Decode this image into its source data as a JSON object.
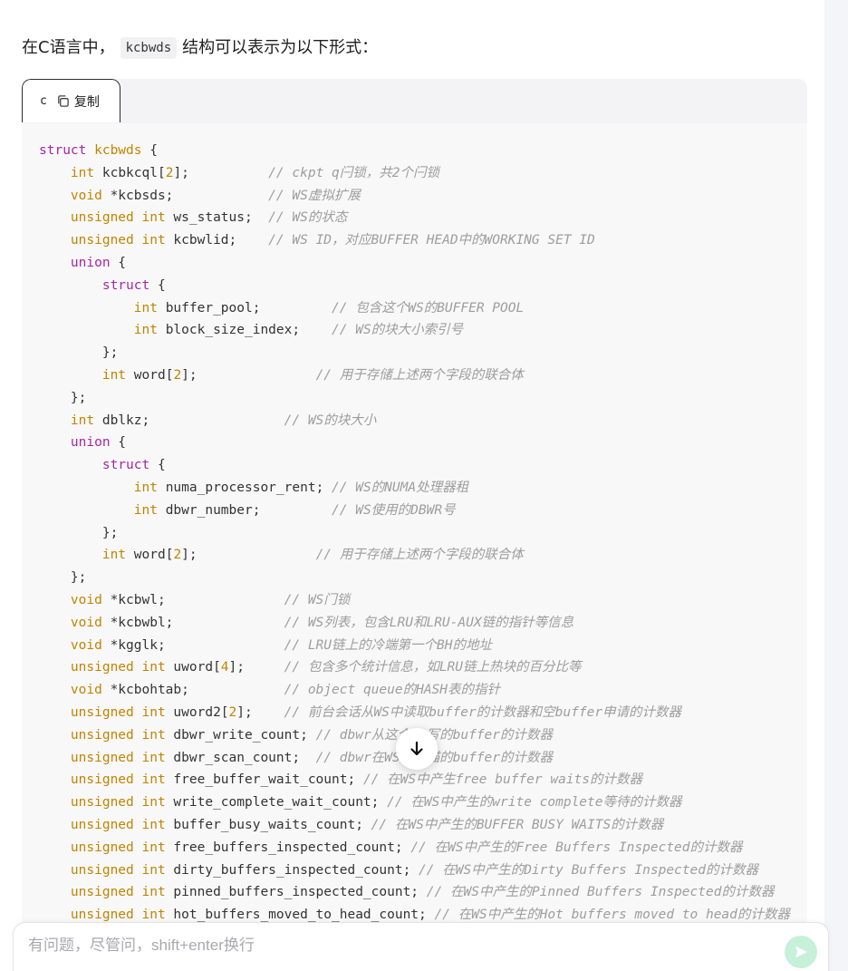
{
  "intro": {
    "before": "在C语言中，",
    "code": "kcbwds",
    "after": "结构可以表示为以下形式："
  },
  "code_tab": {
    "language": "c",
    "copy_label": "复制"
  },
  "code_lines": [
    [
      {
        "t": "kw",
        "v": "struct "
      },
      {
        "t": "ty",
        "v": "kcbwds"
      },
      {
        "t": "p",
        "v": " {"
      }
    ],
    [
      {
        "t": "p",
        "v": "    "
      },
      {
        "t": "ty",
        "v": "int"
      },
      {
        "t": "p",
        "v": " kcbkcql["
      },
      {
        "t": "n",
        "v": "2"
      },
      {
        "t": "p",
        "v": "];          "
      },
      {
        "t": "c",
        "v": "// ckpt q闩锁，共2个闩锁"
      }
    ],
    [
      {
        "t": "p",
        "v": "    "
      },
      {
        "t": "ty",
        "v": "void"
      },
      {
        "t": "p",
        "v": " *kcbsds;            "
      },
      {
        "t": "c",
        "v": "// WS虚拟扩展"
      }
    ],
    [
      {
        "t": "p",
        "v": "    "
      },
      {
        "t": "ty",
        "v": "unsigned int"
      },
      {
        "t": "p",
        "v": " ws_status;  "
      },
      {
        "t": "c",
        "v": "// WS的状态"
      }
    ],
    [
      {
        "t": "p",
        "v": "    "
      },
      {
        "t": "ty",
        "v": "unsigned int"
      },
      {
        "t": "p",
        "v": " kcbwlid;    "
      },
      {
        "t": "c",
        "v": "// WS ID，对应BUFFER HEAD中的WORKING SET ID"
      }
    ],
    [
      {
        "t": "p",
        "v": "    "
      },
      {
        "t": "kw",
        "v": "union"
      },
      {
        "t": "p",
        "v": " {"
      }
    ],
    [
      {
        "t": "p",
        "v": "        "
      },
      {
        "t": "kw",
        "v": "struct"
      },
      {
        "t": "p",
        "v": " {"
      }
    ],
    [
      {
        "t": "p",
        "v": "            "
      },
      {
        "t": "ty",
        "v": "int"
      },
      {
        "t": "p",
        "v": " buffer_pool;         "
      },
      {
        "t": "c",
        "v": "// 包含这个WS的BUFFER POOL"
      }
    ],
    [
      {
        "t": "p",
        "v": "            "
      },
      {
        "t": "ty",
        "v": "int"
      },
      {
        "t": "p",
        "v": " block_size_index;    "
      },
      {
        "t": "c",
        "v": "// WS的块大小索引号"
      }
    ],
    [
      {
        "t": "p",
        "v": "        };"
      }
    ],
    [
      {
        "t": "p",
        "v": "        "
      },
      {
        "t": "ty",
        "v": "int"
      },
      {
        "t": "p",
        "v": " word["
      },
      {
        "t": "n",
        "v": "2"
      },
      {
        "t": "p",
        "v": "];               "
      },
      {
        "t": "c",
        "v": "// 用于存储上述两个字段的联合体"
      }
    ],
    [
      {
        "t": "p",
        "v": "    };"
      }
    ],
    [
      {
        "t": "p",
        "v": "    "
      },
      {
        "t": "ty",
        "v": "int"
      },
      {
        "t": "p",
        "v": " dblkz;                 "
      },
      {
        "t": "c",
        "v": "// WS的块大小"
      }
    ],
    [
      {
        "t": "p",
        "v": "    "
      },
      {
        "t": "kw",
        "v": "union"
      },
      {
        "t": "p",
        "v": " {"
      }
    ],
    [
      {
        "t": "p",
        "v": "        "
      },
      {
        "t": "kw",
        "v": "struct"
      },
      {
        "t": "p",
        "v": " {"
      }
    ],
    [
      {
        "t": "p",
        "v": "            "
      },
      {
        "t": "ty",
        "v": "int"
      },
      {
        "t": "p",
        "v": " numa_processor_rent; "
      },
      {
        "t": "c",
        "v": "// WS的NUMA处理器租"
      }
    ],
    [
      {
        "t": "p",
        "v": "            "
      },
      {
        "t": "ty",
        "v": "int"
      },
      {
        "t": "p",
        "v": " dbwr_number;         "
      },
      {
        "t": "c",
        "v": "// WS使用的DBWR号"
      }
    ],
    [
      {
        "t": "p",
        "v": "        };"
      }
    ],
    [
      {
        "t": "p",
        "v": "        "
      },
      {
        "t": "ty",
        "v": "int"
      },
      {
        "t": "p",
        "v": " word["
      },
      {
        "t": "n",
        "v": "2"
      },
      {
        "t": "p",
        "v": "];               "
      },
      {
        "t": "c",
        "v": "// 用于存储上述两个字段的联合体"
      }
    ],
    [
      {
        "t": "p",
        "v": "    };"
      }
    ],
    [
      {
        "t": "p",
        "v": "    "
      },
      {
        "t": "ty",
        "v": "void"
      },
      {
        "t": "p",
        "v": " *kcbwl;               "
      },
      {
        "t": "c",
        "v": "// WS门锁"
      }
    ],
    [
      {
        "t": "p",
        "v": "    "
      },
      {
        "t": "ty",
        "v": "void"
      },
      {
        "t": "p",
        "v": " *kcbwbl;              "
      },
      {
        "t": "c",
        "v": "// WS列表，包含LRU和LRU-AUX链的指针等信息"
      }
    ],
    [
      {
        "t": "p",
        "v": "    "
      },
      {
        "t": "ty",
        "v": "void"
      },
      {
        "t": "p",
        "v": " *kgglk;               "
      },
      {
        "t": "c",
        "v": "// LRU链上的冷端第一个BH的地址"
      }
    ],
    [
      {
        "t": "p",
        "v": "    "
      },
      {
        "t": "ty",
        "v": "unsigned int"
      },
      {
        "t": "p",
        "v": " uword["
      },
      {
        "t": "n",
        "v": "4"
      },
      {
        "t": "p",
        "v": "];     "
      },
      {
        "t": "c",
        "v": "// 包含多个统计信息，如LRU链上热块的百分比等"
      }
    ],
    [
      {
        "t": "p",
        "v": "    "
      },
      {
        "t": "ty",
        "v": "void"
      },
      {
        "t": "p",
        "v": " *kcbohtab;            "
      },
      {
        "t": "c",
        "v": "// object queue的HASH表的指针"
      }
    ],
    [
      {
        "t": "p",
        "v": "    "
      },
      {
        "t": "ty",
        "v": "unsigned int"
      },
      {
        "t": "p",
        "v": " uword2["
      },
      {
        "t": "n",
        "v": "2"
      },
      {
        "t": "p",
        "v": "];    "
      },
      {
        "t": "c",
        "v": "// 前台会话从WS中读取buffer的计数器和空buffer申请的计数器"
      }
    ],
    [
      {
        "t": "p",
        "v": "    "
      },
      {
        "t": "ty",
        "v": "unsigned int"
      },
      {
        "t": "p",
        "v": " dbwr_write_count; "
      },
      {
        "t": "c",
        "v": "// dbwr从这个WS写的buffer的计数器"
      }
    ],
    [
      {
        "t": "p",
        "v": "    "
      },
      {
        "t": "ty",
        "v": "unsigned int"
      },
      {
        "t": "p",
        "v": " dbwr_scan_count;  "
      },
      {
        "t": "c",
        "v": "// dbwr在WS中扫描的buffer的计数器"
      }
    ],
    [
      {
        "t": "p",
        "v": "    "
      },
      {
        "t": "ty",
        "v": "unsigned int"
      },
      {
        "t": "p",
        "v": " free_buffer_wait_count; "
      },
      {
        "t": "c",
        "v": "// 在WS中产生free buffer waits的计数器"
      }
    ],
    [
      {
        "t": "p",
        "v": "    "
      },
      {
        "t": "ty",
        "v": "unsigned int"
      },
      {
        "t": "p",
        "v": " write_complete_wait_count; "
      },
      {
        "t": "c",
        "v": "// 在WS中产生的write complete等待的计数器"
      }
    ],
    [
      {
        "t": "p",
        "v": "    "
      },
      {
        "t": "ty",
        "v": "unsigned int"
      },
      {
        "t": "p",
        "v": " buffer_busy_waits_count; "
      },
      {
        "t": "c",
        "v": "// 在WS中产生的BUFFER BUSY WAITS的计数器"
      }
    ],
    [
      {
        "t": "p",
        "v": "    "
      },
      {
        "t": "ty",
        "v": "unsigned int"
      },
      {
        "t": "p",
        "v": " free_buffers_inspected_count; "
      },
      {
        "t": "c",
        "v": "// 在WS中产生的Free Buffers Inspected的计数器"
      }
    ],
    [
      {
        "t": "p",
        "v": "    "
      },
      {
        "t": "ty",
        "v": "unsigned int"
      },
      {
        "t": "p",
        "v": " dirty_buffers_inspected_count; "
      },
      {
        "t": "c",
        "v": "// 在WS中产生的Dirty Buffers Inspected的计数器"
      }
    ],
    [
      {
        "t": "p",
        "v": "    "
      },
      {
        "t": "ty",
        "v": "unsigned int"
      },
      {
        "t": "p",
        "v": " pinned_buffers_inspected_count; "
      },
      {
        "t": "c",
        "v": "// 在WS中产生的Pinned Buffers Inspected的计数器"
      }
    ],
    [
      {
        "t": "p",
        "v": "    "
      },
      {
        "t": "ty",
        "v": "unsigned int"
      },
      {
        "t": "p",
        "v": " hot_buffers_moved_to_head_count; "
      },
      {
        "t": "c",
        "v": "// 在WS中产生的Hot buffers moved to head的计数器"
      }
    ]
  ],
  "chat_input": {
    "placeholder": "有问题，尽管问，shift+enter换行"
  },
  "icons": {
    "copy": "copy-icon",
    "scroll_down": "arrow-down-icon",
    "send": "send-icon"
  },
  "colors": {
    "keyword": "#a626a4",
    "type": "#c18401",
    "comment": "#9d9d9f",
    "send_button": "#c6f0da"
  }
}
